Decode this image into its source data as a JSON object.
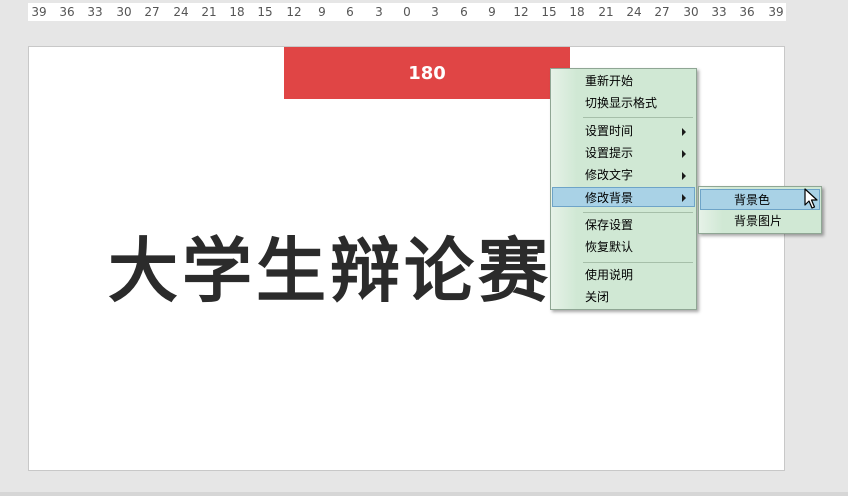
{
  "ruler": {
    "ticks": [
      "39",
      "36",
      "33",
      "30",
      "27",
      "24",
      "21",
      "18",
      "15",
      "12",
      "9",
      "6",
      "3",
      "0",
      "3",
      "6",
      "9",
      "12",
      "15",
      "18",
      "21",
      "24",
      "27",
      "30",
      "33",
      "36",
      "39"
    ]
  },
  "slide": {
    "timer_value": "180",
    "title": "大学生辩论赛"
  },
  "context_menu": {
    "items": [
      {
        "label": "重新开始",
        "submenu": false
      },
      {
        "label": "切换显示格式",
        "submenu": false
      },
      {
        "label": "设置时间",
        "submenu": true
      },
      {
        "label": "设置提示",
        "submenu": true
      },
      {
        "label": "修改文字",
        "submenu": true
      },
      {
        "label": "修改背景",
        "submenu": true
      },
      {
        "label": "保存设置",
        "submenu": false
      },
      {
        "label": "恢复默认",
        "submenu": false
      },
      {
        "label": "使用说明",
        "submenu": false
      },
      {
        "label": "关闭",
        "submenu": false
      }
    ],
    "active_item": "修改背景"
  },
  "submenu": {
    "items": [
      {
        "label": "背景色"
      },
      {
        "label": "背景图片"
      }
    ],
    "active_item": "背景色"
  },
  "colors": {
    "timer_bar": "#e04545",
    "menu_bg": "#d0e8d4",
    "menu_highlight": "#a9d2e6",
    "title_text": "#2b2b2b"
  }
}
